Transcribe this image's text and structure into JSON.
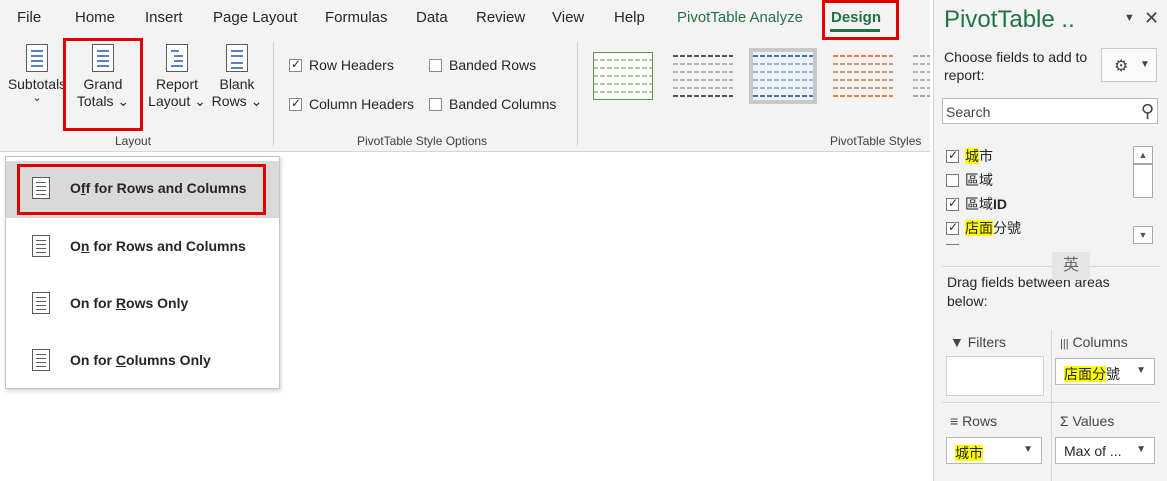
{
  "tabs": {
    "file": "File",
    "home": "Home",
    "insert": "Insert",
    "page_layout": "Page Layout",
    "formulas": "Formulas",
    "data": "Data",
    "review": "Review",
    "view": "View",
    "help": "Help",
    "pivot_analyze": "PivotTable Analyze",
    "design": "Design"
  },
  "ribbon": {
    "subtotals": "Subtotals",
    "subtotals_chevron": "⌄",
    "grand": "Grand",
    "totals": "Totals ⌄",
    "report": "Report",
    "layout_btn": "Layout ⌄",
    "blank": "Blank",
    "rows_btn": "Rows ⌄",
    "layout_group": "Layout",
    "row_headers": "Row Headers",
    "banded_rows": "Banded Rows",
    "column_headers": "Column Headers",
    "banded_columns": "Banded Columns",
    "style_options_group": "PivotTable Style Options",
    "styles_group": "PivotTable Styles"
  },
  "menu": {
    "item1": {
      "pre": "O",
      "u": "f",
      "post": "f for Rows and Columns"
    },
    "item2": {
      "pre": "O",
      "u": "n",
      "post": " for Rows and Columns"
    },
    "item3": {
      "pre": "On for ",
      "u": "R",
      "post": "ows Only"
    },
    "item4": {
      "pre": "On for ",
      "u": "C",
      "post": "olumns Only"
    }
  },
  "pane": {
    "title": "PivotTable ..",
    "dropdown": "▼",
    "close": "✕",
    "choose": "Choose fields to add to report:",
    "search_placeholder": "Search",
    "fields": {
      "f1": {
        "hl": "城",
        "rest": "市"
      },
      "f2": {
        "rest": "區域"
      },
      "f3": {
        "main": "區域",
        "bold": "ID"
      },
      "f4": {
        "hl": "店面",
        "rest": "分號"
      }
    },
    "ime": "英",
    "drag": "Drag fields between areas below:",
    "filters": "Filters",
    "columns": "Columns",
    "rows": "Rows",
    "values": "Values",
    "columns_pill": {
      "hl": "店面分",
      "rest": "號"
    },
    "rows_pill": {
      "hl": "城市"
    },
    "values_pill": "Max of ...",
    "pill_chevron": "▼"
  }
}
